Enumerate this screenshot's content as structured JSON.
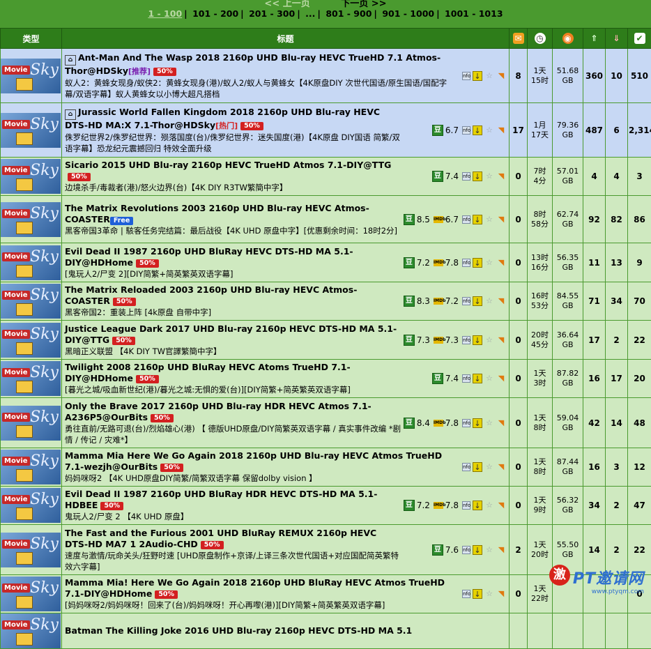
{
  "pager": {
    "prev": "<< 上一页",
    "next": "下一页 >>",
    "pages": [
      "1 - 100",
      "101 - 200",
      "201 - 300",
      "...",
      "801 - 900",
      "901 - 1000",
      "1001 - 1013"
    ]
  },
  "header": {
    "type": "类型",
    "title": "标题"
  },
  "category_label": "Movie",
  "category_brand": "Sky",
  "rows": [
    {
      "title": "Ant-Man And The Wasp 2018 2160p UHD Blu-ray HEVC TrueHD 7.1 Atmos-Thor@HDSky",
      "tag": "[推荐]",
      "badge": "50%",
      "sub": "蚁人2：黄蜂女现身/蚁侠2：黄蜂女现身(港)/蚁人2/蚁人与黄蜂女【4K原盘DIY 次世代国语/原生国语/国配字幕/双语字幕】蚁人黄蜂女以小博大超凡搭档",
      "db": "",
      "imdb": "",
      "comments": "8",
      "time": "1天\n15时",
      "size": "51.68\nGB",
      "seeders": "360",
      "leechers": "10",
      "done": "510"
    },
    {
      "title": "Jurassic World Fallen Kingdom 2018 2160p UHD Blu-ray HEVC DTS-HD MA:X 7.1-Thor@HDSky",
      "tag": "[热门]",
      "badge": "50%",
      "sub": "侏罗纪世界2/侏罗纪世界：殒落国度(台)/侏罗纪世界：迷失国度(港)【4K原盘 DIY国语 简繁/双语字幕】恐龙纪元震撼回归 特效全面升级",
      "db": "6.7",
      "imdb": "",
      "comments": "17",
      "time": "1月\n17天",
      "size": "79.36\nGB",
      "seeders": "487",
      "leechers": "6",
      "done": "2,314"
    },
    {
      "title": "Sicario 2015 UHD Blu-ray 2160p HEVC TrueHD Atmos 7.1-DIY@TTG",
      "tag": "",
      "badge": "50%",
      "sub": "边境杀手/毒裁者(港)/怒火边界(台)【4K DIY R3TW繁簡中字】",
      "db": "7.4",
      "imdb": "",
      "comments": "0",
      "time": "7时\n4分",
      "size": "57.01\nGB",
      "seeders": "4",
      "leechers": "4",
      "done": "3"
    },
    {
      "title": "The Matrix Revolutions 2003 2160p UHD Blu-ray HEVC Atmos-COASTER",
      "tag": "",
      "badge": "",
      "free": "Free",
      "sub": "黑客帝国3革命 | 駭客任务完结篇：最后战役【4K UHD 原盘中字】[优惠剩余时间：18时2分]",
      "db": "8.5",
      "imdb": "6.7",
      "comments": "0",
      "time": "8时\n58分",
      "size": "62.74\nGB",
      "seeders": "92",
      "leechers": "82",
      "done": "86"
    },
    {
      "title": "Evil Dead II 1987 2160p UHD BluRay HEVC DTS-HD MA 5.1-DIY@HDHome",
      "tag": "",
      "badge": "50%",
      "sub": "[鬼玩人2/尸变 2][DIY简繁+简英繁英双语字幕]",
      "db": "7.2",
      "imdb": "7.8",
      "comments": "0",
      "time": "13时\n16分",
      "size": "56.35\nGB",
      "seeders": "11",
      "leechers": "13",
      "done": "9"
    },
    {
      "title": "The Matrix Reloaded 2003 2160p UHD Blu-ray HEVC Atmos-COASTER",
      "tag": "",
      "badge": "50%",
      "sub": "黑客帝国2：重装上阵 [4k原盘 自带中字]",
      "db": "8.3",
      "imdb": "7.2",
      "comments": "0",
      "time": "16时\n53分",
      "size": "84.55\nGB",
      "seeders": "71",
      "leechers": "34",
      "done": "70"
    },
    {
      "title": "Justice League Dark 2017 UHD Blu-ray 2160p HEVC DTS-HD MA 5.1-DIY@TTG",
      "tag": "",
      "badge": "50%",
      "sub": "黑暗正义联盟 【4K DIY TW官譯繁簡中字】",
      "db": "7.3",
      "imdb": "7.3",
      "comments": "0",
      "time": "20时\n45分",
      "size": "36.64\nGB",
      "seeders": "17",
      "leechers": "2",
      "done": "22"
    },
    {
      "title": "Twilight 2008 2160p UHD BluRay HEVC Atoms TrueHD 7.1-DIY@HDHome",
      "tag": "",
      "badge": "50%",
      "sub": "[暮光之城/吸血新世纪(港)/暮光之城:无惧的爱(台)][DIY简繁+简英繁英双语字幕]",
      "db": "7.4",
      "imdb": "",
      "comments": "0",
      "time": "1天\n3时",
      "size": "87.82\nGB",
      "seeders": "16",
      "leechers": "17",
      "done": "20"
    },
    {
      "title": "Only the Brave 2017 2160p UHD Blu-ray HDR HEVC Atmos 7.1-A236P5@OurBits",
      "tag": "",
      "badge": "50%",
      "sub": "勇往直前/无路可退(台)/烈焰雄心(港) 【 德版UHD原盘/DIY简繁英双语字幕 / 真实事件改编 *剧情 / 传记 / 灾难*】",
      "db": "8.4",
      "imdb": "7.8",
      "comments": "0",
      "time": "1天\n8时",
      "size": "59.04\nGB",
      "seeders": "42",
      "leechers": "14",
      "done": "48"
    },
    {
      "title": "Mamma Mia Here We Go Again 2018 2160p UHD Blu-ray HEVC Atmos TrueHD 7.1-wezjh@OurBits",
      "tag": "",
      "badge": "50%",
      "sub": "妈妈咪呀2 【4K UHD原盘DIY简繁/简繁双语字幕 保留dolby vision 】",
      "db": "",
      "imdb": "",
      "comments": "0",
      "time": "1天\n8时",
      "size": "87.44\nGB",
      "seeders": "16",
      "leechers": "3",
      "done": "12"
    },
    {
      "title": "Evil Dead II 1987 2160p UHD BluRay HDR HEVC DTS-HD MA 5.1-HDBEE",
      "tag": "",
      "badge": "50%",
      "sub": "鬼玩人2/尸变 2 【4K UHD 原盘】",
      "db": "7.2",
      "imdb": "7.8",
      "comments": "0",
      "time": "1天\n9时",
      "size": "56.32\nGB",
      "seeders": "34",
      "leechers": "2",
      "done": "47"
    },
    {
      "title": "The Fast and the Furious 2001 UHD BluRay REMUX 2160p HEVC DTS-HD MA7 1 2Audio-CHD",
      "tag": "",
      "badge": "50%",
      "sub": "速度与激情/玩命关头/狂野时速 [UHD原盘制作+京译/上译三条次世代国语+对应国配简英繁特效六字幕]",
      "db": "7.6",
      "imdb": "",
      "comments": "2",
      "time": "1天\n20时",
      "size": "55.50\nGB",
      "seeders": "14",
      "leechers": "2",
      "done": "22"
    },
    {
      "title": "Mamma Mia! Here We Go Again 2018 2160p UHD BluRay HEVC Atmos TrueHD 7.1-DIY@HDHome",
      "tag": "",
      "badge": "50%",
      "sub": "[妈妈咪呀2/妈妈咪呀！回来了(台)/妈妈咪呀！开心再嚟(港)][DIY简繁+简英繁英双语字幕]",
      "db": "",
      "imdb": "",
      "comments": "0",
      "time": "1天\n22时",
      "size": "",
      "seeders": "",
      "leechers": "",
      "done": "0"
    },
    {
      "title": "Batman The Killing Joke 2016 UHD Blu-ray 2160p HEVC DTS-HD MA 5.1",
      "tag": "",
      "badge": "",
      "sub": "",
      "db": "",
      "imdb": "",
      "comments": "",
      "time": "",
      "size": "",
      "seeders": "",
      "leechers": "",
      "done": ""
    }
  ],
  "watermark": {
    "text": "PT邀请网",
    "url": "www.ptyqm.com",
    "logo": "激"
  }
}
